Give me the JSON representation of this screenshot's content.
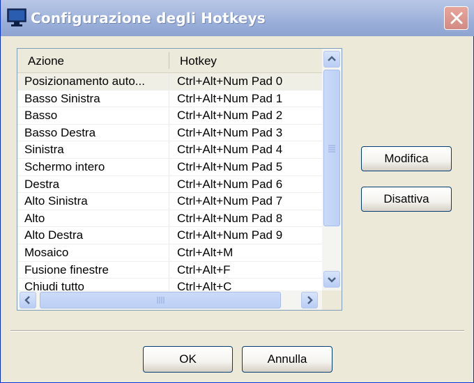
{
  "window": {
    "title": "Configurazione degli Hotkeys",
    "icon": "monitor-icon"
  },
  "table": {
    "columns": [
      "Azione",
      "Hotkey"
    ],
    "rows": [
      {
        "action": "Posizionamento auto...",
        "hotkey": "Ctrl+Alt+Num Pad 0",
        "selected": true
      },
      {
        "action": "Basso Sinistra",
        "hotkey": "Ctrl+Alt+Num Pad 1"
      },
      {
        "action": "Basso",
        "hotkey": "Ctrl+Alt+Num Pad 2"
      },
      {
        "action": "Basso Destra",
        "hotkey": "Ctrl+Alt+Num Pad 3"
      },
      {
        "action": "Sinistra",
        "hotkey": "Ctrl+Alt+Num Pad 4"
      },
      {
        "action": "Schermo intero",
        "hotkey": "Ctrl+Alt+Num Pad 5"
      },
      {
        "action": "Destra",
        "hotkey": "Ctrl+Alt+Num Pad 6"
      },
      {
        "action": "Alto Sinistra",
        "hotkey": "Ctrl+Alt+Num Pad 7"
      },
      {
        "action": "Alto",
        "hotkey": "Ctrl+Alt+Num Pad 8"
      },
      {
        "action": "Alto Destra",
        "hotkey": "Ctrl+Alt+Num Pad 9"
      },
      {
        "action": "Mosaico",
        "hotkey": "Ctrl+Alt+M"
      },
      {
        "action": "Fusione finestre",
        "hotkey": "Ctrl+Alt+F"
      },
      {
        "action": "Chiudi tutto",
        "hotkey": "Ctrl+Alt+C"
      }
    ]
  },
  "side_buttons": {
    "modify": "Modifica",
    "disable": "Disattiva"
  },
  "footer_buttons": {
    "ok": "OK",
    "cancel": "Annulla"
  },
  "colors": {
    "titlebar": "#9aafd9",
    "close_button": "#d28b82",
    "button_border": "#003c74",
    "scroll_accent": "#4d6185"
  }
}
